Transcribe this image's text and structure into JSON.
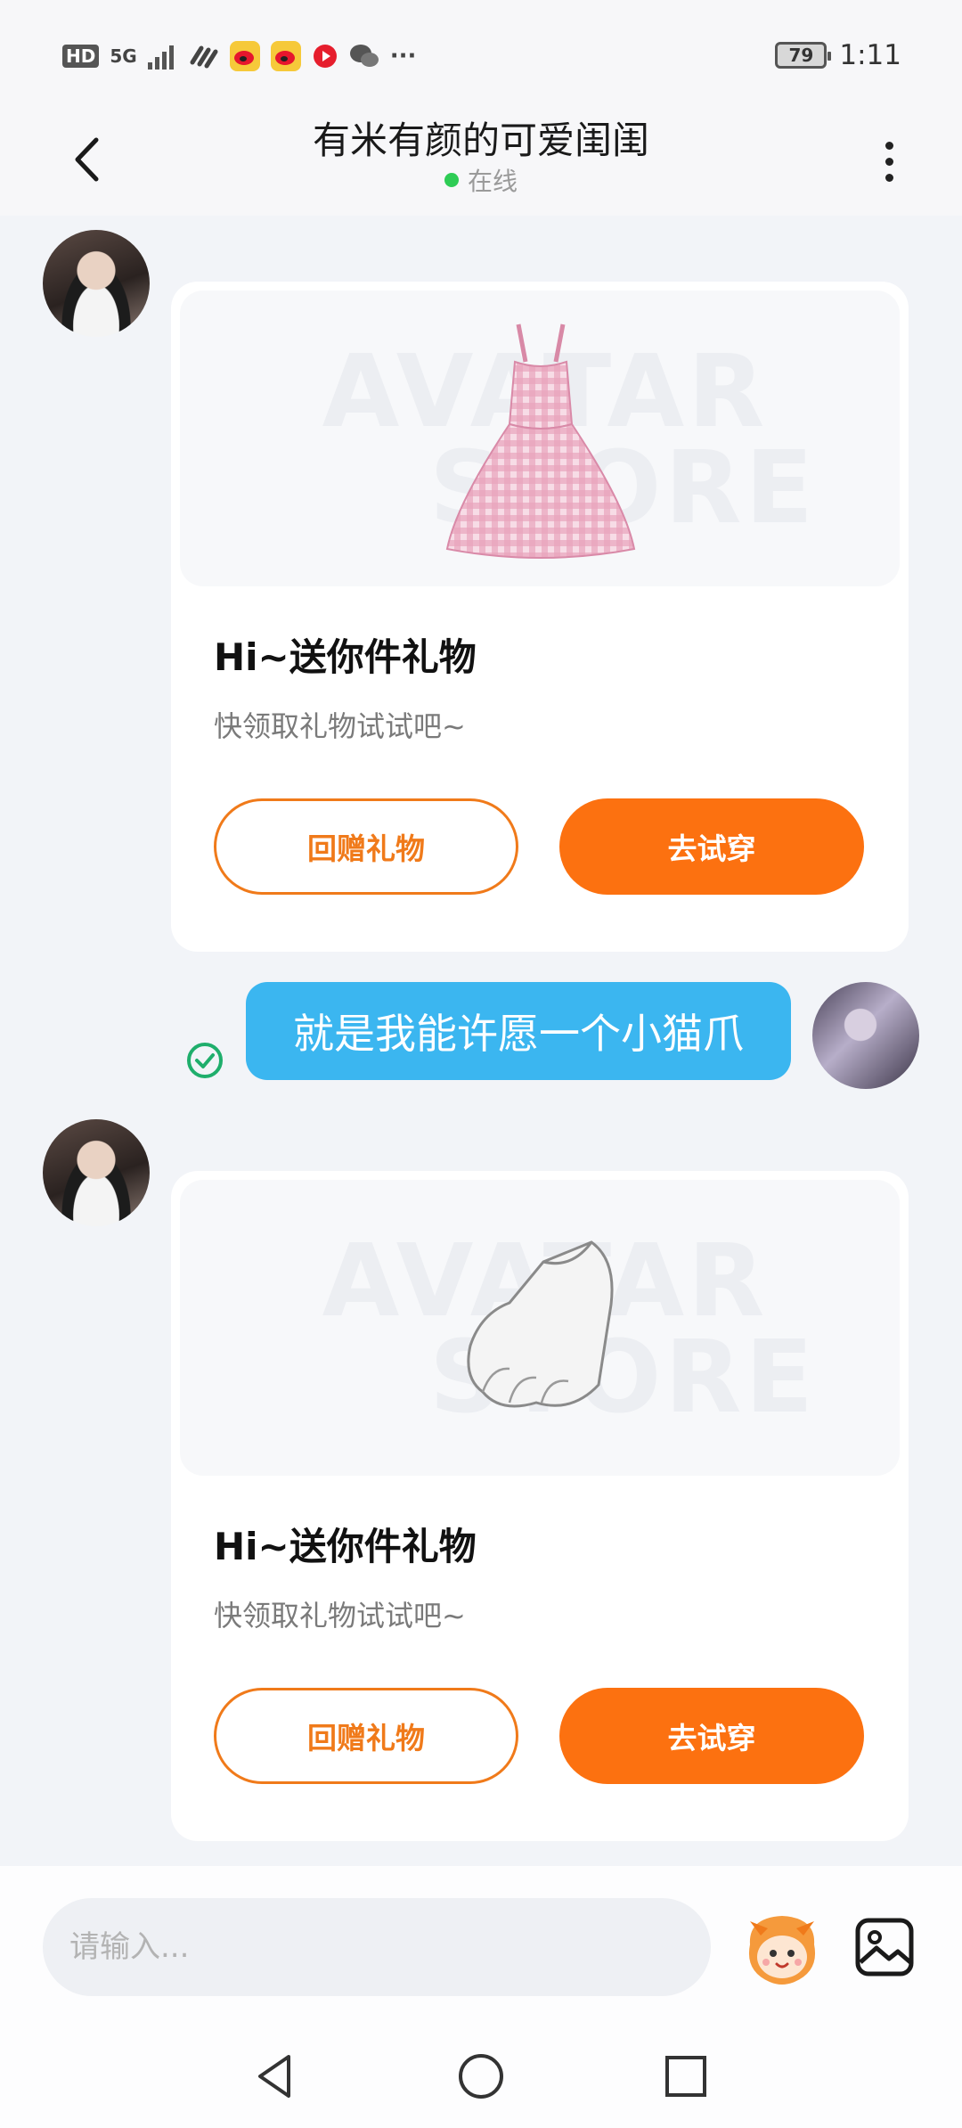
{
  "status_bar": {
    "network_badge": "HD",
    "network_type": "5G",
    "app_icons": [
      "link-icon",
      "weibo-icon",
      "weibo-icon",
      "video-icon",
      "wechat-icon"
    ],
    "overflow": "···",
    "battery": "79",
    "time": "1:11"
  },
  "header": {
    "title": "有米有颜的可爱闺闺",
    "status": "在线",
    "status_color": "#2ecc55"
  },
  "messages": [
    {
      "type": "gift",
      "image": "pink-gingham-dress",
      "watermark": [
        "AVATAR",
        "STORE"
      ],
      "title": "Hi~送你件礼物",
      "subtitle": "快领取礼物试试吧~",
      "secondary_button": "回赠礼物",
      "primary_button": "去试穿"
    },
    {
      "type": "text",
      "from": "me",
      "text": "就是我能许愿一个小猫爪",
      "status": "read"
    },
    {
      "type": "gift",
      "image": "cat-paw-glove",
      "watermark": [
        "AVATAR",
        "STORE"
      ],
      "title": "Hi~送你件礼物",
      "subtitle": "快领取礼物试试吧~",
      "secondary_button": "回赠礼物",
      "primary_button": "去试穿"
    }
  ],
  "input": {
    "placeholder": "请输入..."
  },
  "colors": {
    "accent": "#fc7110",
    "bubble": "#3bb6f0"
  }
}
